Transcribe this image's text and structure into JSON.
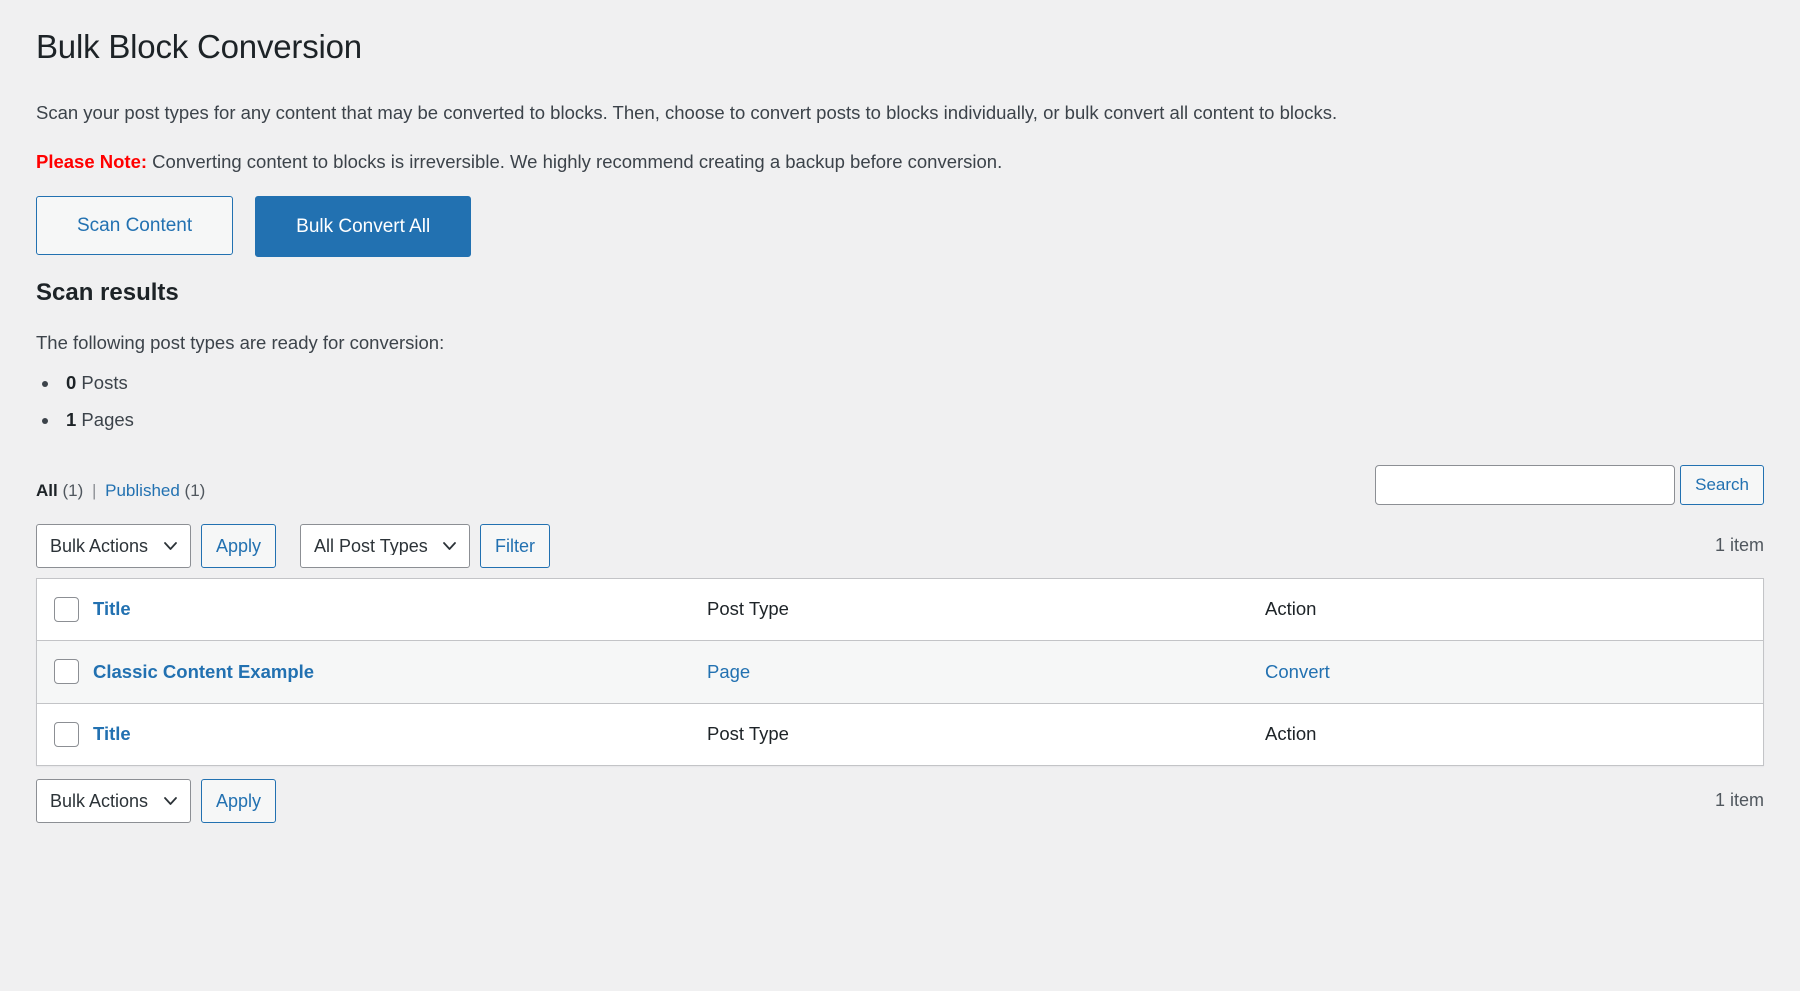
{
  "page": {
    "title": "Bulk Block Conversion",
    "intro": "Scan your post types for any content that may be converted to blocks. Then, choose to convert posts to blocks individually, or bulk convert all content to blocks.",
    "note_label": "Please Note:",
    "note_text": " Converting content to blocks is irreversible. We highly recommend creating a backup before conversion."
  },
  "actions": {
    "scan_label": "Scan Content",
    "bulk_convert_label": "Bulk Convert All"
  },
  "scan_results": {
    "heading": "Scan results",
    "lead": "The following post types are ready for conversion:",
    "items": [
      {
        "count": "0",
        "label": " Posts"
      },
      {
        "count": "1",
        "label": " Pages"
      }
    ]
  },
  "views": {
    "all_label": "All",
    "all_count": "(1)",
    "separator": "|",
    "published_label": "Published",
    "published_count": "(1)"
  },
  "search": {
    "value": "",
    "placeholder": "",
    "button_label": "Search"
  },
  "tablenav_top": {
    "bulk_actions_selected": "Bulk Actions",
    "bulk_actions_options": [
      "Bulk Actions"
    ],
    "apply_label": "Apply",
    "post_types_selected": "All Post Types",
    "post_types_options": [
      "All Post Types"
    ],
    "filter_label": "Filter",
    "displaying_num": "1 item"
  },
  "tablenav_bottom": {
    "bulk_actions_selected": "Bulk Actions",
    "apply_label": "Apply",
    "displaying_num": "1 item"
  },
  "table": {
    "columns": {
      "title": "Title",
      "post_type": "Post Type",
      "action": "Action"
    },
    "rows": [
      {
        "title": "Classic Content Example",
        "post_type": "Page",
        "action": "Convert"
      }
    ]
  },
  "colors": {
    "accent": "#2271b1",
    "warning": "#ff0000",
    "page_bg": "#f0f0f1",
    "row_bg": "#f6f7f7",
    "border": "#c3c4c7"
  },
  "icons": {
    "chevron_down": "chevron-down-icon",
    "checkbox": "checkbox-icon"
  }
}
